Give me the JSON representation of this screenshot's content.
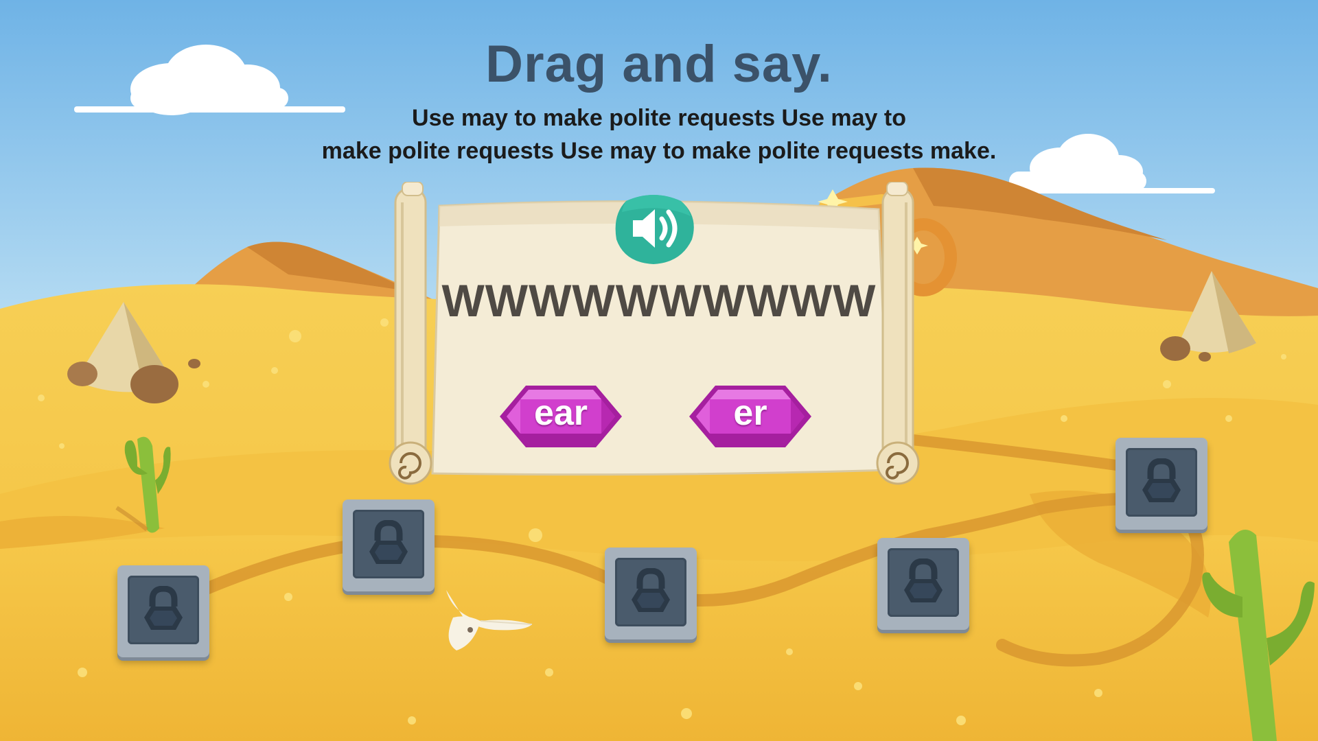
{
  "activity": {
    "title": "Drag and say.",
    "instruction_lines": [
      "Use may to make polite requests Use may to",
      "make polite requests Use may to make polite requests make."
    ]
  },
  "card": {
    "word": "WWWWWWWWWW",
    "audio_icon": "speaker-icon"
  },
  "answer_options": [
    {
      "label": "ear"
    },
    {
      "label": "er"
    }
  ],
  "level_path": {
    "nodes": [
      {
        "state": "locked",
        "icon": "lock-icon"
      },
      {
        "state": "locked",
        "icon": "lock-icon"
      },
      {
        "state": "locked",
        "icon": "lock-icon"
      },
      {
        "state": "locked",
        "icon": "lock-icon"
      },
      {
        "state": "locked",
        "icon": "lock-icon"
      }
    ]
  },
  "colors": {
    "sky_top": "#6fb3e6",
    "sand": "#f2bd3c",
    "title_color": "#3b5269",
    "audio_button": "#2fb39b",
    "gem_magenta": "#c632c2",
    "lock_frame": "#a7b2bd"
  }
}
